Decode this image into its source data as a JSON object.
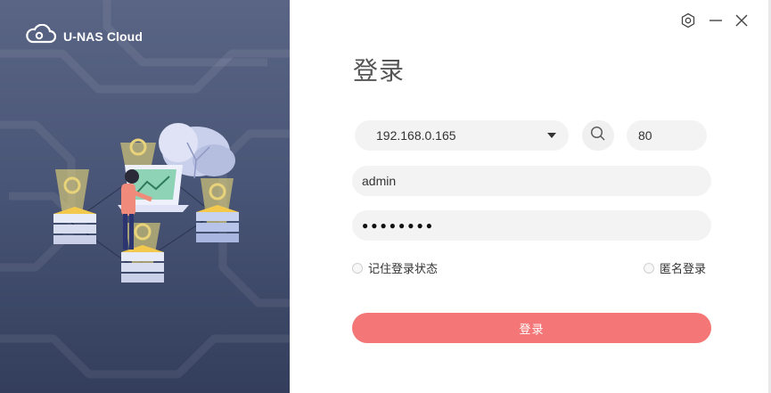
{
  "brand": {
    "name": "U-NAS Cloud",
    "logo_icon": "cloud-logo-icon"
  },
  "window_controls": {
    "settings_icon": "hexagon-settings-icon",
    "minimize_icon": "minimize-icon",
    "close_icon": "close-icon"
  },
  "login": {
    "title": "登录",
    "host": {
      "value": "192.168.0.165"
    },
    "port": {
      "value": "80"
    },
    "username": {
      "value": "admin"
    },
    "password": {
      "masked": "●●●●●●●●"
    },
    "remember_label": "记住登录状态",
    "anonymous_label": "匿名登录",
    "submit_label": "登录"
  },
  "colors": {
    "accent": "#f47676",
    "panel_top": "#5a6585",
    "panel_bottom": "#333e5c",
    "field_bg": "#f3f3f3"
  }
}
